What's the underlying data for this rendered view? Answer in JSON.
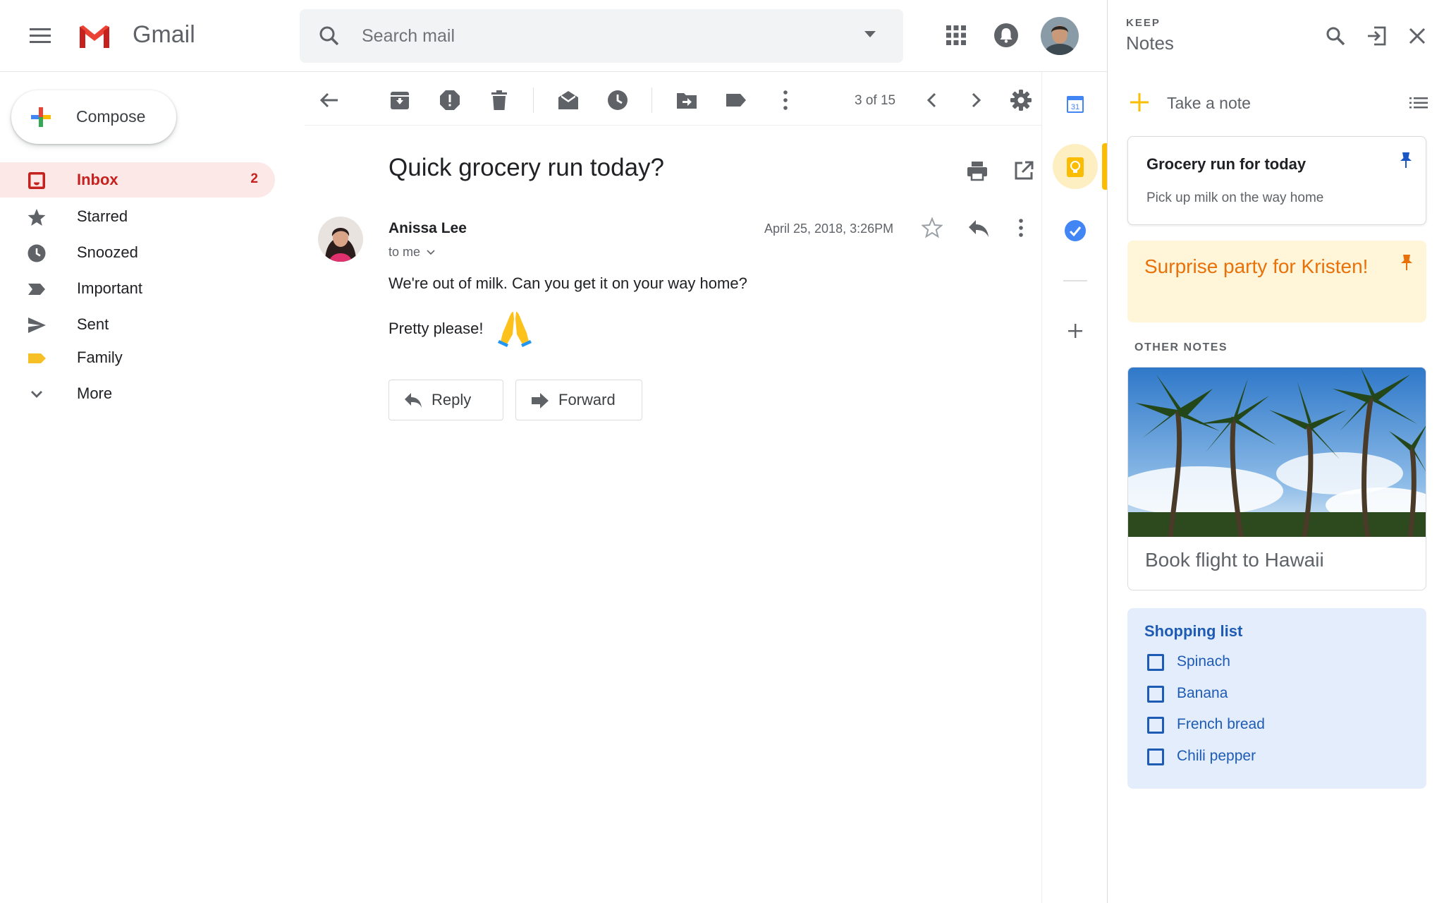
{
  "header": {
    "app_name": "Gmail",
    "search_placeholder": "Search mail"
  },
  "nav": {
    "compose_label": "Compose",
    "items": [
      {
        "label": "Inbox",
        "icon": "inbox-icon",
        "count": "2",
        "active": true
      },
      {
        "label": "Starred",
        "icon": "star-icon"
      },
      {
        "label": "Snoozed",
        "icon": "clock-icon"
      },
      {
        "label": "Important",
        "icon": "important-icon"
      },
      {
        "label": "Sent",
        "icon": "send-icon"
      },
      {
        "label": "Family",
        "icon": "label-icon",
        "color": "#f6bf26"
      },
      {
        "label": "More",
        "icon": "chevron-down-icon"
      }
    ]
  },
  "toolbar": {
    "page_count": "3 of 15"
  },
  "message": {
    "subject": "Quick grocery run today?",
    "sender": "Anissa Lee",
    "to": "to me",
    "date": "April 25, 2018, 3:26PM",
    "body_line1": "We're out of milk. Can you get it on your way home?",
    "body_line2": "Pretty please!",
    "reply_label": "Reply",
    "forward_label": "Forward"
  },
  "rail": {
    "calendar_day": "31"
  },
  "keep": {
    "brand": "KEEP",
    "title": "Notes",
    "take_note": "Take a note",
    "note1_title": "Grocery run for today",
    "note1_body": "Pick up milk on the way home",
    "note2_title": "Surprise party for Kristen!",
    "other_notes_label": "OTHER NOTES",
    "note3_title": "Book flight to Hawaii",
    "note4_title": "Shopping list",
    "list_items": [
      "Spinach",
      "Banana",
      "French bread",
      "Chili pepper"
    ]
  },
  "colors": {
    "gmail_red": "#c5221f",
    "keep_yellow": "#fbbc04",
    "list_blue": "#1e5bb5",
    "note_yellow_bg": "#fff5d9",
    "note_blue_bg": "#e3edfb"
  }
}
